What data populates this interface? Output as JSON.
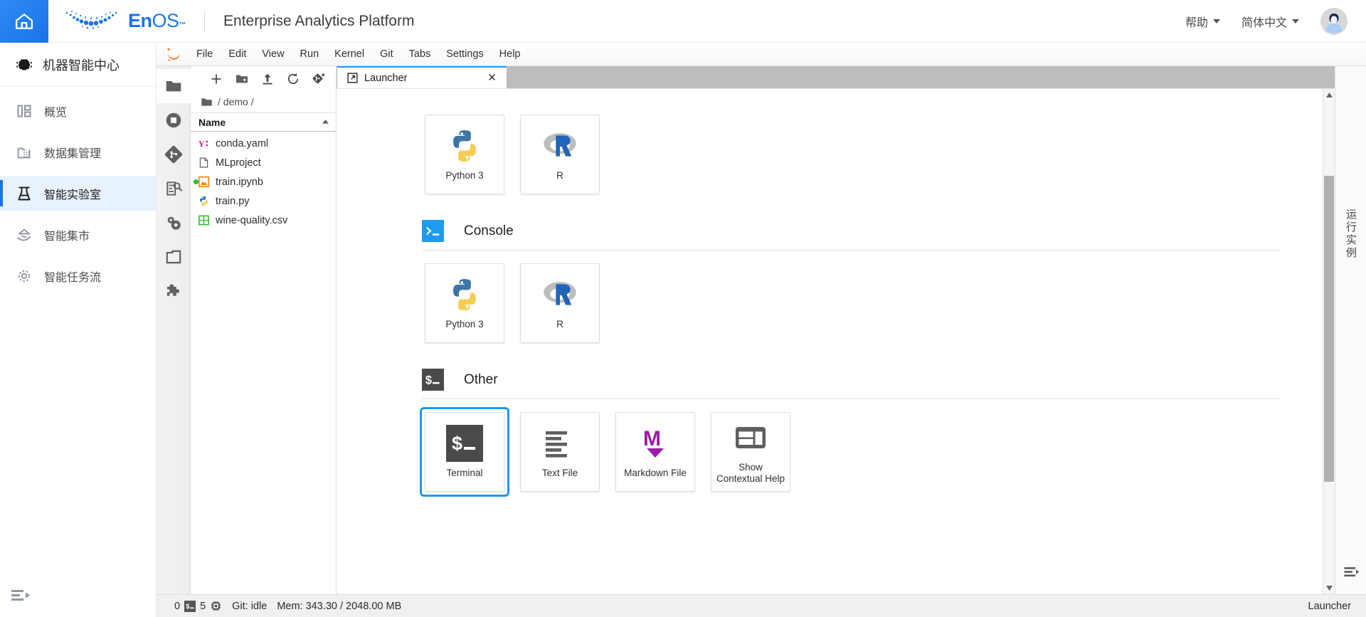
{
  "topbar": {
    "home_icon": "home-icon",
    "brand_name_en": "En",
    "brand_name_os": "OS",
    "brand_tm": "™",
    "app_title": "Enterprise Analytics Platform",
    "help_label": "帮助",
    "language_label": "简体中文",
    "avatar_icon": "user-avatar"
  },
  "sidebar": {
    "header": "机器智能中心",
    "header_icon": "machine-intelligence-icon",
    "items": [
      {
        "label": "概览",
        "icon": "overview-icon",
        "active": false
      },
      {
        "label": "数据集管理",
        "icon": "dataset-icon",
        "active": false
      },
      {
        "label": "智能实验室",
        "icon": "lab-flask-icon",
        "active": true
      },
      {
        "label": "智能集市",
        "icon": "marketplace-icon",
        "active": false
      },
      {
        "label": "智能任务流",
        "icon": "workflow-icon",
        "active": false
      }
    ],
    "collapse_icon": "collapse-sidebar-icon"
  },
  "jupyter": {
    "logo_icon": "jupyter-logo",
    "menu": [
      "File",
      "Edit",
      "View",
      "Run",
      "Kernel",
      "Git",
      "Tabs",
      "Settings",
      "Help"
    ],
    "activitybar": [
      {
        "icon": "folder-icon",
        "name": "file-browser",
        "active": true
      },
      {
        "icon": "running-sessions-icon",
        "name": "running-terminals-kernels",
        "active": false
      },
      {
        "icon": "git-icon",
        "name": "git-panel",
        "active": false
      },
      {
        "icon": "document-search-icon",
        "name": "table-of-contents",
        "active": false
      },
      {
        "icon": "gears-icon",
        "name": "property-inspector",
        "active": false
      },
      {
        "icon": "tabs-icon",
        "name": "open-tabs",
        "active": false
      },
      {
        "icon": "puzzle-icon",
        "name": "extension-manager",
        "active": false
      }
    ],
    "filebrowser": {
      "toolbar": [
        {
          "icon": "plus-icon",
          "name": "new-launcher"
        },
        {
          "icon": "new-folder-icon",
          "name": "new-folder"
        },
        {
          "icon": "upload-icon",
          "name": "upload-files"
        },
        {
          "icon": "refresh-icon",
          "name": "refresh-file-list"
        },
        {
          "icon": "git-clone-icon",
          "name": "git-clone"
        }
      ],
      "breadcrumb": "/ demo /",
      "breadcrumb_icon": "folder-icon",
      "column_header": "Name",
      "sort_direction": "ascending",
      "files": [
        {
          "name": "conda.yaml",
          "icon": "yaml-file-icon",
          "running": false
        },
        {
          "name": "MLproject",
          "icon": "generic-file-icon",
          "running": false
        },
        {
          "name": "train.ipynb",
          "icon": "notebook-file-icon",
          "running": true
        },
        {
          "name": "train.py",
          "icon": "python-file-icon",
          "running": false
        },
        {
          "name": "wine-quality.csv",
          "icon": "csv-file-icon",
          "running": false
        }
      ]
    },
    "tab": {
      "label": "Launcher",
      "icon": "launcher-icon",
      "close_icon": "close-icon"
    },
    "launcher": {
      "sections": [
        {
          "name": "notebook",
          "title": "",
          "icon": "",
          "show_header": false,
          "cards": [
            {
              "label": "Python 3",
              "icon": "python-logo",
              "focused": false
            },
            {
              "label": "R",
              "icon": "r-logo",
              "focused": false
            }
          ]
        },
        {
          "name": "console",
          "title": "Console",
          "icon": "console-icon",
          "show_header": true,
          "cards": [
            {
              "label": "Python 3",
              "icon": "python-logo",
              "focused": false
            },
            {
              "label": "R",
              "icon": "r-logo",
              "focused": false
            }
          ]
        },
        {
          "name": "other",
          "title": "Other",
          "icon": "terminal-icon",
          "show_header": true,
          "cards": [
            {
              "label": "Terminal",
              "icon": "terminal-icon",
              "focused": true
            },
            {
              "label": "Text File",
              "icon": "text-file-icon",
              "focused": false
            },
            {
              "label": "Markdown File",
              "icon": "markdown-icon",
              "focused": false
            },
            {
              "label": "Show Contextual Help",
              "icon": "contextual-help-icon",
              "focused": false
            }
          ]
        }
      ]
    },
    "rightrail": {
      "label": "运行实例",
      "toggle_icon": "toggle-right-panel-icon"
    },
    "statusbar": {
      "terminal_count": "0",
      "terminal_icon": "terminal-icon",
      "kernel_count": "5",
      "kernel_icon": "kernel-icon",
      "git_status": "Git: idle",
      "memory": "Mem: 343.30 / 2048.00 MB",
      "active_widget": "Launcher"
    }
  },
  "colors": {
    "accent_blue": "#1a73e8",
    "tab_blue": "#2196f3",
    "active_item_bg": "#e8f1fe",
    "python_blue": "#3c75a6",
    "python_yellow": "#f5cd51",
    "r_blue": "#2065b8",
    "markdown_purple": "#9c1ba8",
    "running_green": "#2ec12e",
    "yaml_pink": "#d4176c",
    "notebook_orange": "#f57c00",
    "csv_green": "#2eb82e",
    "jupyter_orange": "#f37726"
  }
}
